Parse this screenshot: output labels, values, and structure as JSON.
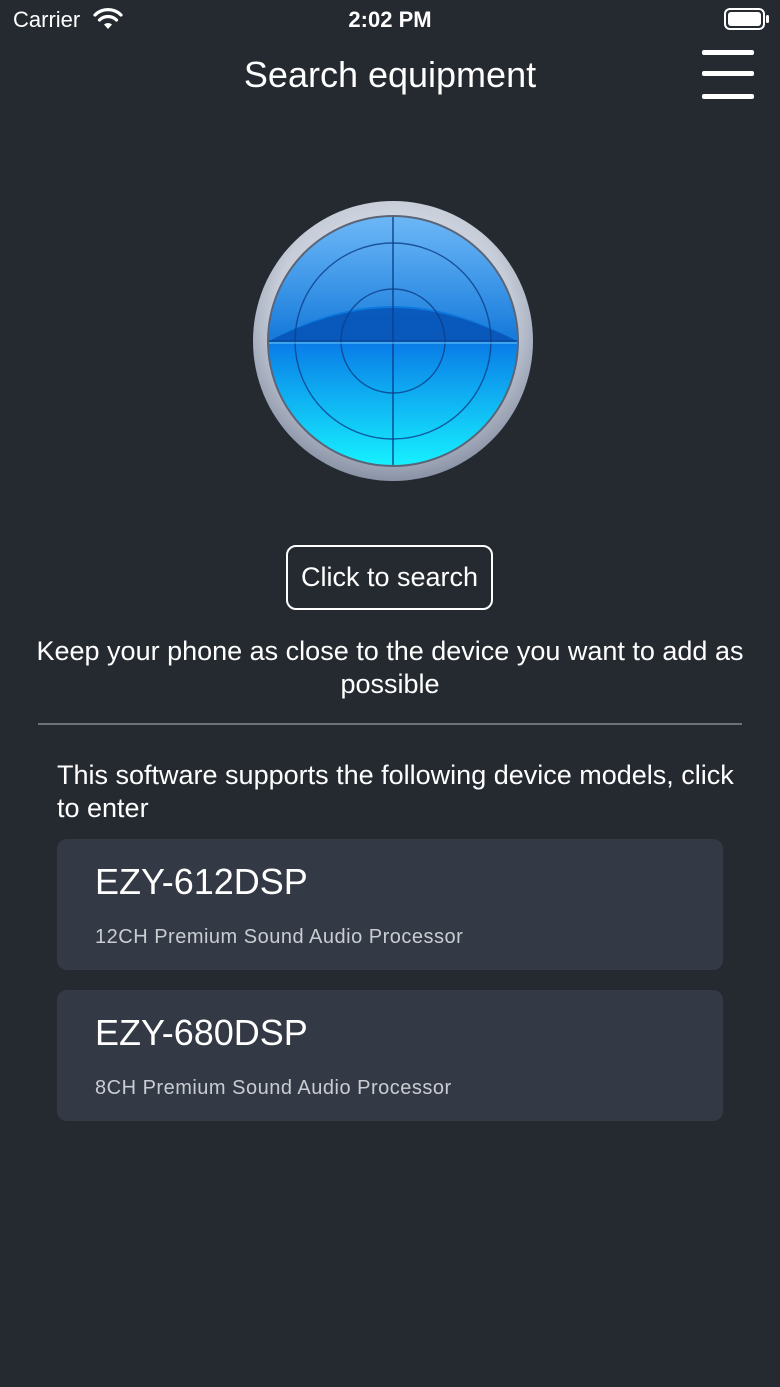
{
  "status_bar": {
    "carrier": "Carrier",
    "time": "2:02 PM"
  },
  "nav": {
    "title": "Search equipment",
    "menu_icon": "hamburger-menu-icon"
  },
  "search": {
    "button_label": "Click to search",
    "hint": "Keep your phone as close to the device you want to add as possible"
  },
  "devices": {
    "intro": "This software supports the following device models, click to enter",
    "items": [
      {
        "name": "EZY-612DSP",
        "description": "12CH Premium Sound Audio Processor"
      },
      {
        "name": "EZY-680DSP",
        "description": "8CH Premium Sound Audio Processor"
      }
    ]
  },
  "colors": {
    "background": "#252a31",
    "card": "#343a45",
    "radar_blue": "#0a8cf0",
    "radar_cyan": "#19e6ff"
  }
}
